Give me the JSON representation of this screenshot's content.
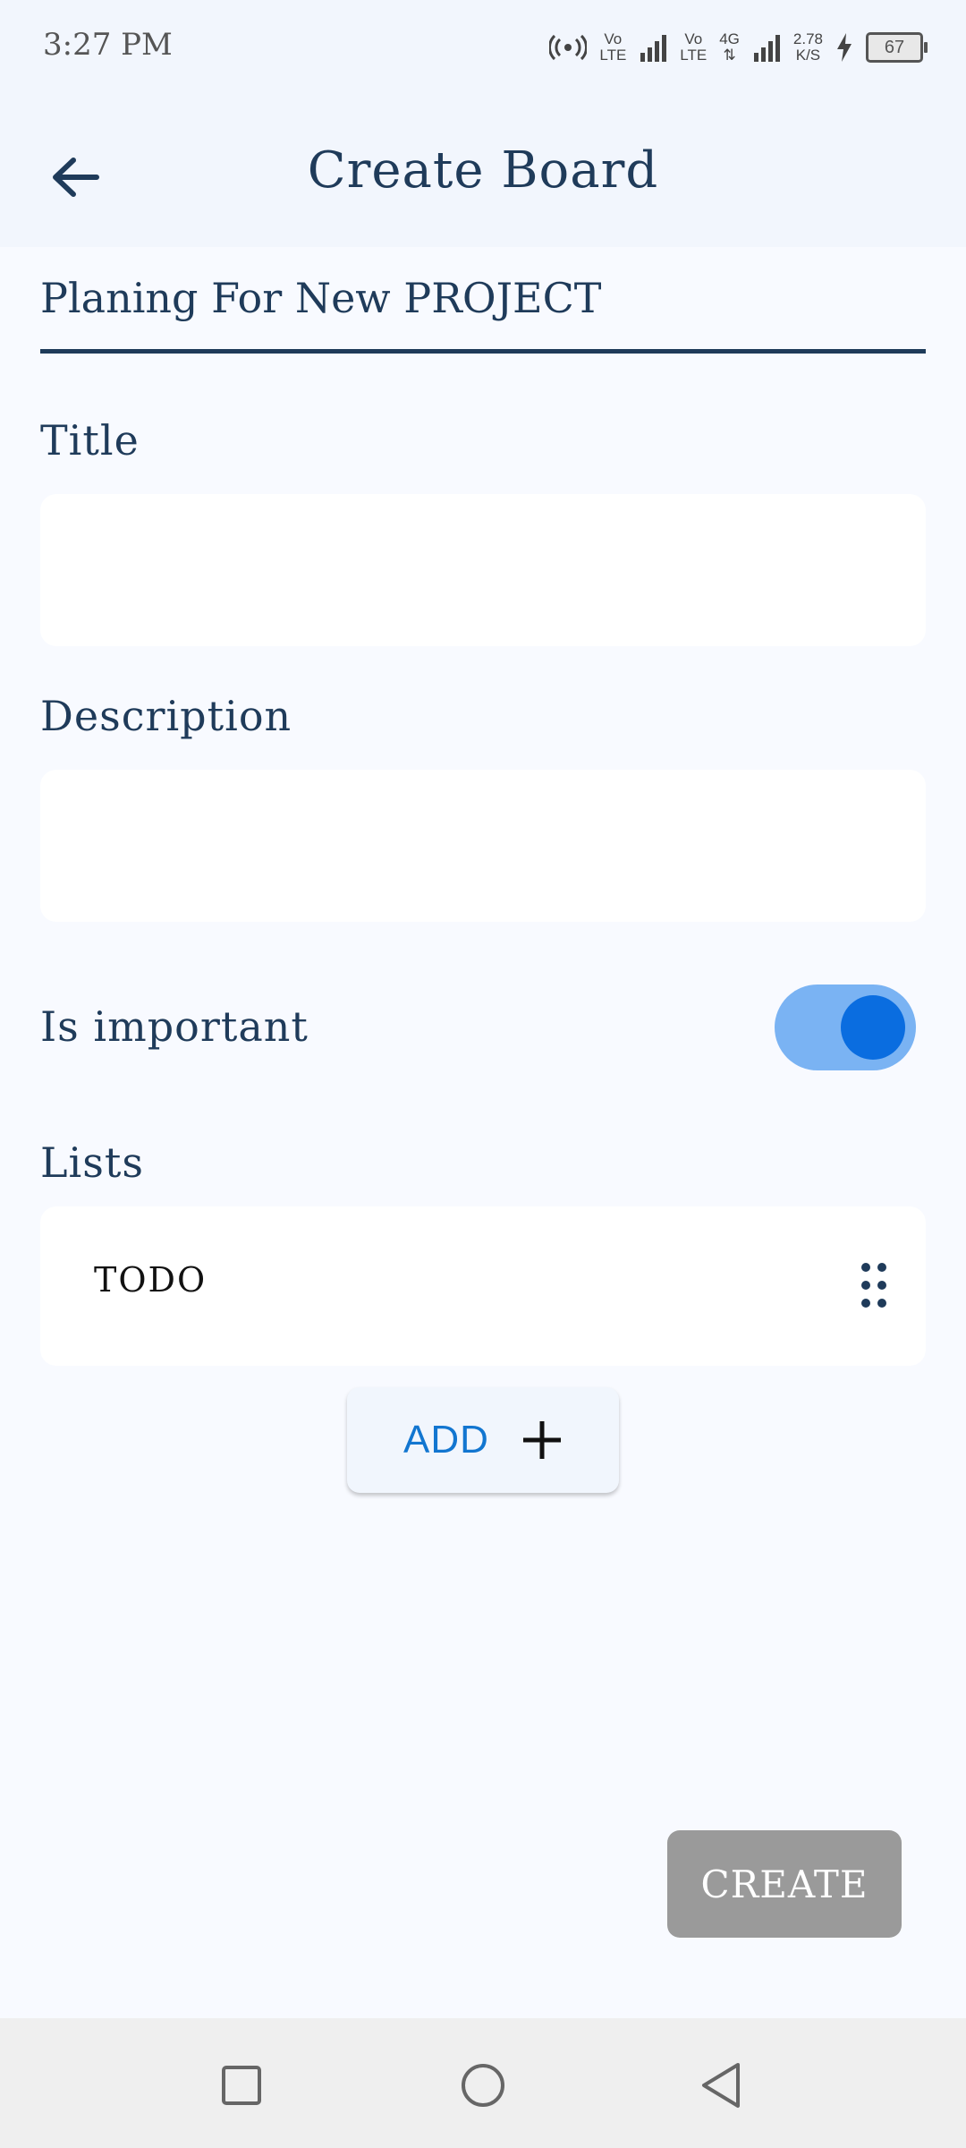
{
  "status_bar": {
    "time": "3:27 PM",
    "vo_lte_1": [
      "Vo",
      "LTE"
    ],
    "vo_lte_2": [
      "Vo",
      "LTE"
    ],
    "network": "4G",
    "speed": [
      "2.78",
      "K/S"
    ],
    "battery": "67"
  },
  "app_bar": {
    "title": "Create Board",
    "back_icon": "arrow-left-icon"
  },
  "form": {
    "board_name_value": "Planing For New PROJECT",
    "title_label": "Title",
    "title_value": "",
    "description_label": "Description",
    "description_value": "",
    "important_label": "Is important",
    "important_on": true,
    "lists_label": "Lists",
    "lists": [
      {
        "label": "TODO"
      }
    ],
    "add_label": "ADD",
    "create_label": "CREATE"
  },
  "colors": {
    "primary_text": "#1f3b5a",
    "accent": "#0a6de0",
    "toggle_track": "#7ab3f3",
    "create_disabled": "#9a9a9a"
  },
  "nav_bar": {
    "icons": [
      "square-icon",
      "circle-icon",
      "triangle-back-icon"
    ]
  }
}
